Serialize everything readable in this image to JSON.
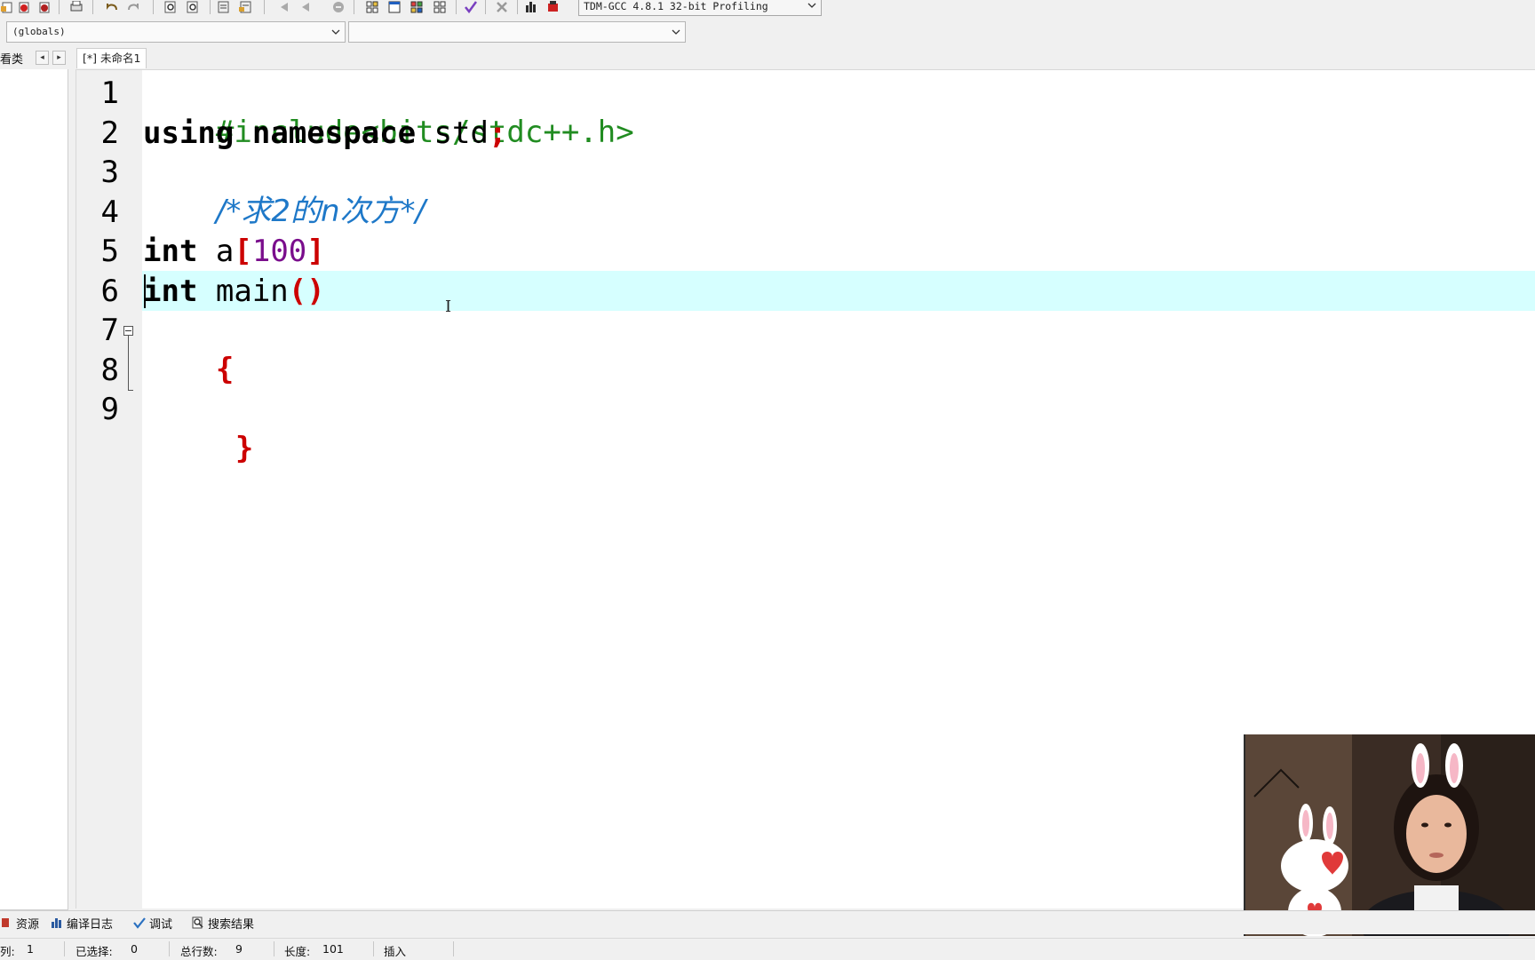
{
  "toolbar": {
    "compiler_selected": "TDM-GCC 4.8.1 32-bit Profiling",
    "icons": [
      "new-file-icon",
      "close-file-icon",
      "close-all-icon",
      "print-icon",
      "undo-icon",
      "redo-icon",
      "find-icon",
      "replace-icon",
      "indent-icon",
      "unindent-icon",
      "back-icon",
      "forward-icon",
      "stop-icon",
      "compile-icon",
      "run-icon",
      "compile-run-icon",
      "rebuild-icon",
      "check-syntax-icon",
      "delete-icon",
      "chart-icon",
      "debug-icon"
    ]
  },
  "scope": {
    "globals": "(globals)",
    "member": ""
  },
  "left_panel": {
    "tab_label": "看类"
  },
  "editor": {
    "file_tab": "[*] 未命名1",
    "line_numbers": [
      "1",
      "2",
      "3",
      "4",
      "5",
      "6",
      "7",
      "8",
      "9"
    ],
    "lines": {
      "l1": "#include<bits/stdc++.h>",
      "l2_kw1": "using",
      "l2_kw2": "namespace",
      "l2_rest": " std",
      "l2_semi": ";",
      "l3": "/*求2的n次方*/",
      "l5_kw": "int",
      "l5_id": " a",
      "l5_lb": "[",
      "l5_num": "100",
      "l5_rb": "]",
      "l6_kw": "int",
      "l6_id": " main",
      "l6_paren": "()",
      "l7": "{",
      "l9": "}"
    },
    "active_line": 6
  },
  "bottom_tabs": {
    "resources": "资源",
    "compile_log": "编译日志",
    "debug": "调试",
    "search_results": "搜索结果"
  },
  "status": {
    "col_label": "列:",
    "col_value": "1",
    "selected_label": "已选择:",
    "selected_value": "0",
    "lines_label": "总行数:",
    "lines_value": "9",
    "length_label": "长度:",
    "length_value": "101",
    "mode": "插入"
  },
  "colors": {
    "preprocessor": "#218c21",
    "comment": "#1e78c8",
    "symbol": "#cc0000",
    "number": "#7a0d8c",
    "active_line": "#d6ffff"
  }
}
